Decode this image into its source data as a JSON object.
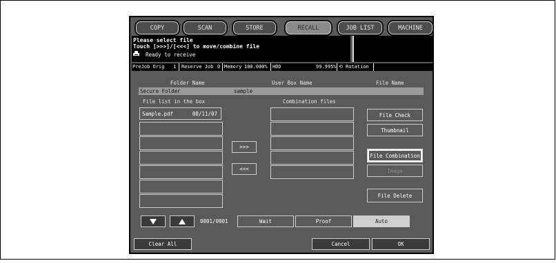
{
  "tabs": [
    "COPY",
    "SCAN",
    "STORE",
    "RECALL",
    "JOB LIST",
    "MACHINE"
  ],
  "message": {
    "line1": "Please select file",
    "line2": "Touch [>>>]/[<<<] to move/combine file",
    "line3": "Ready to receive"
  },
  "status": {
    "prejob_label": "PreJob Orig",
    "prejob_value": "1",
    "reserve_label": "Reserve Job",
    "reserve_value": "0",
    "memory_label": "Memory",
    "memory_value": "100.000%",
    "hdd_label": "HDD",
    "hdd_value": "99.995%",
    "rotation_label": "Rotation"
  },
  "headers": {
    "folder": "Folder Name",
    "userbox": "User Box Name",
    "file": "File Name"
  },
  "selection": {
    "folder": "Secure Folder",
    "userbox": "sample",
    "file": ""
  },
  "file_list_title": "File list in the box",
  "combination_title": "Combination files",
  "files": [
    {
      "name": "Sample.pdf",
      "date": "08/11/07"
    }
  ],
  "move_right_label": ">>>",
  "move_left_label": "<<<",
  "side_buttons": {
    "file_check": "File Check",
    "thumbnail": "Thumbnail",
    "file_combination": "File Combination",
    "image": "Image",
    "file_delete": "File Delete"
  },
  "page_counter": "0001/0001",
  "mode_buttons": {
    "wait": "Wait",
    "proof": "Proof",
    "auto": "Auto"
  },
  "bottom": {
    "clear_all": "Clear All",
    "cancel": "Cancel",
    "ok": "OK"
  }
}
